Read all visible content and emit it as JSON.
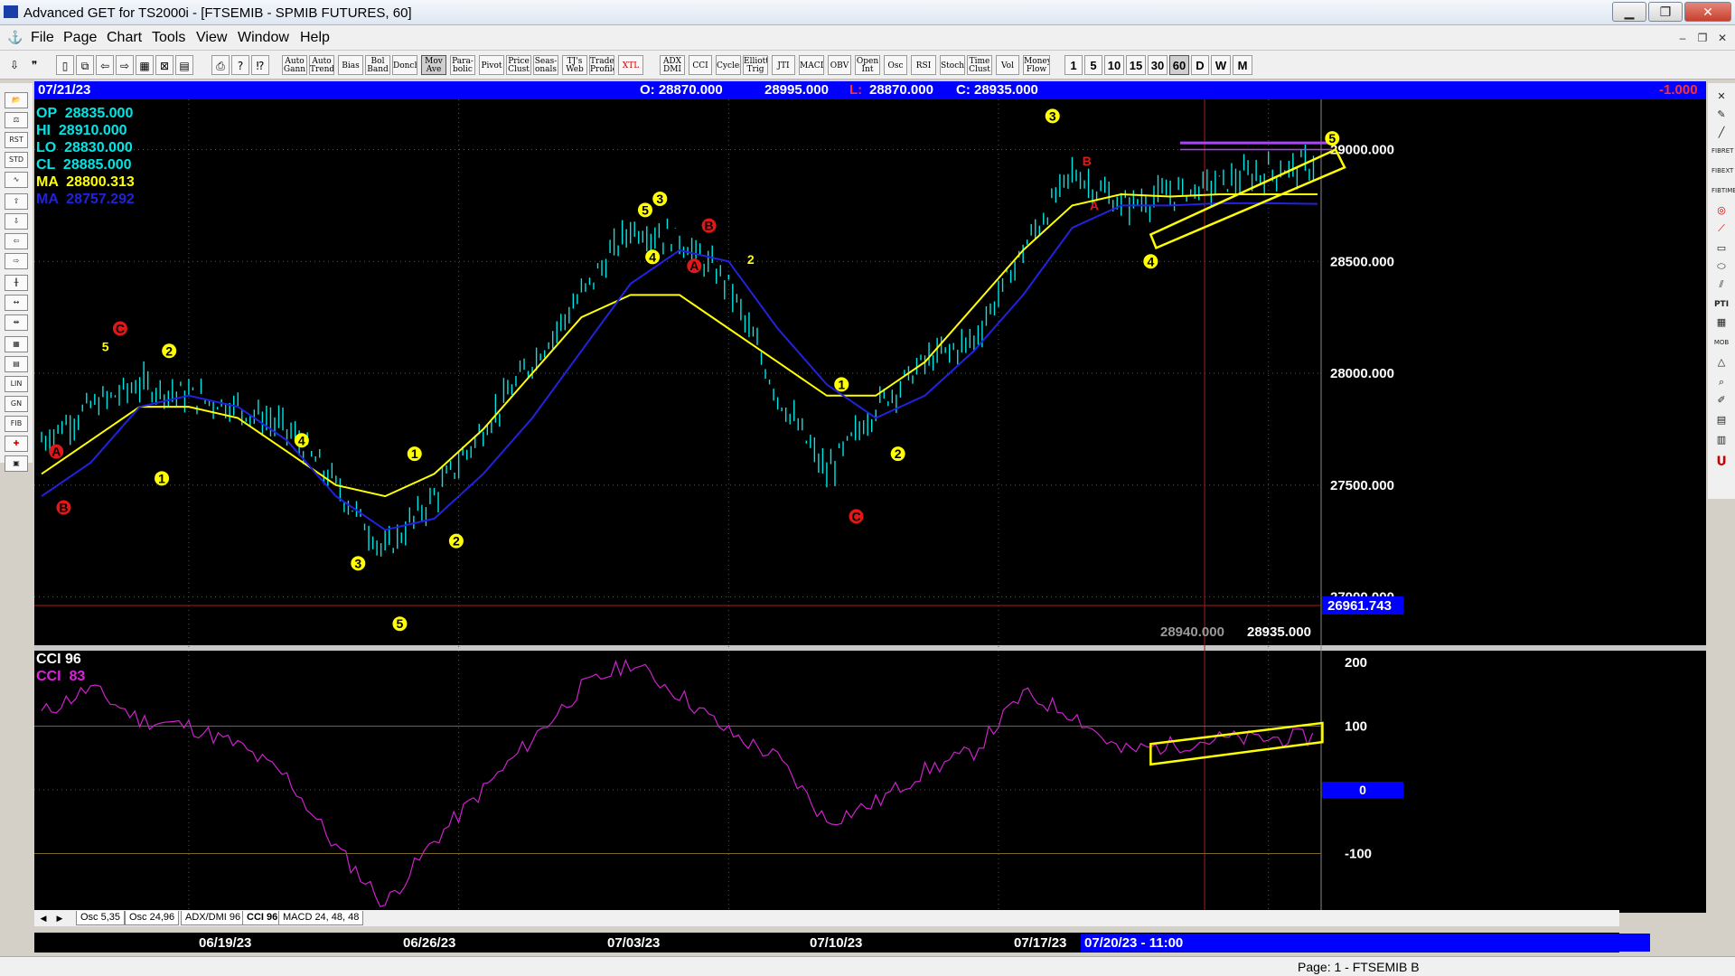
{
  "window": {
    "title": "Advanced GET for TS2000i - [FTSEMIB - SPMIB FUTURES, 60]",
    "controls": {
      "minimize": "▁",
      "maximize": "❐",
      "close": "✕"
    }
  },
  "menu": {
    "items": [
      "File",
      "Page",
      "Chart",
      "Tools",
      "View",
      "Window",
      "Help"
    ]
  },
  "toolbar": {
    "study_buttons": [
      "Auto Gann",
      "Auto Trend",
      "Bias",
      "Bol Band",
      "Donch",
      "Mov Ave",
      "Para- bolic",
      "Pivot",
      "Price Clust",
      "Seas- onals",
      "TJ's Web",
      "Trade Profile",
      "XTL",
      "ADX DMI",
      "CCI",
      "Cycles",
      "Elliott Trig",
      "JTI",
      "MACD",
      "OBV",
      "Open Int",
      "Osc",
      "RSI",
      "Stoch",
      "Time Clust",
      "Vol",
      "Money Flow"
    ],
    "timeframes": [
      "1",
      "5",
      "10",
      "15",
      "30",
      "60",
      "D",
      "W",
      "M"
    ],
    "active_timeframe": "60"
  },
  "infobar": {
    "date": "07/21/23",
    "open": "O: 28870.000",
    "high": "28995.000",
    "low_label": "L:",
    "low": "28870.000",
    "close": "C: 28935.000",
    "change": "-1.000"
  },
  "ohlc_legend": [
    {
      "label": "OP",
      "value": "28835.000",
      "color": "#00e5e5"
    },
    {
      "label": "HI",
      "value": "28910.000",
      "color": "#00e5e5"
    },
    {
      "label": "LO",
      "value": "28830.000",
      "color": "#00e5e5"
    },
    {
      "label": "CL",
      "value": "28885.000",
      "color": "#00e5e5"
    },
    {
      "label": "MA",
      "value": "28800.313",
      "color": "#ffff00"
    },
    {
      "label": "MA",
      "value": "28757.292",
      "color": "#2222dd"
    }
  ],
  "cci_legend": [
    {
      "label": "CCI 96",
      "color": "#ffffff"
    },
    {
      "label": "CCI  83",
      "color": "#dd22dd"
    }
  ],
  "price_panel": {
    "bottom_readouts": [
      "28940.000",
      "28935.000"
    ],
    "level_badge": "26961.743",
    "level_value": 26961.743
  },
  "tabs": [
    "Osc 5,35",
    "Osc 24,96",
    "ADX/DMI 96",
    "CCI 96",
    "MACD 24, 48, 48"
  ],
  "time_axis": {
    "labels": [
      "06/19/23",
      "06/26/23",
      "07/03/23",
      "07/10/23",
      "07/17/23"
    ],
    "current": "07/20/23 - 11:00"
  },
  "status": "Page: 1 - FTSEMIB B",
  "colors": {
    "price": "#00e5e5",
    "ma_fast": "#ffff00",
    "ma_slow": "#2222dd",
    "cci": "#cc22cc",
    "wave_label": "#ffff00",
    "abc_label": "#e01818",
    "info_bar": "#0000ff"
  },
  "chart_data": [
    {
      "type": "line",
      "name": "FTSEMIB - SPMIB FUTURES, 60",
      "x": [
        "06/15",
        "06/16",
        "06/19",
        "06/20",
        "06/21",
        "06/22",
        "06/23",
        "06/26",
        "06/27",
        "06/28",
        "06/29",
        "06/30",
        "07/03",
        "07/04",
        "07/05",
        "07/06",
        "07/07",
        "07/10",
        "07/11",
        "07/12",
        "07/13",
        "07/14",
        "07/17",
        "07/18",
        "07/19",
        "07/20",
        "07/21"
      ],
      "series": [
        {
          "name": "Price",
          "values": [
            27700,
            27850,
            27950,
            27900,
            27850,
            27750,
            27500,
            27200,
            27450,
            27750,
            28050,
            28350,
            28650,
            28600,
            28400,
            27900,
            27550,
            27850,
            28050,
            28150,
            28550,
            28900,
            28750,
            28800,
            28850,
            28900,
            28935
          ]
        },
        {
          "name": "MA",
          "values": [
            27550,
            27700,
            27850,
            27850,
            27800,
            27650,
            27500,
            27450,
            27550,
            27750,
            28000,
            28250,
            28350,
            28350,
            28200,
            28050,
            27900,
            27900,
            28050,
            28300,
            28550,
            28750,
            28800,
            28790,
            28800,
            28800,
            28800
          ]
        },
        {
          "name": "MA",
          "values": [
            27450,
            27600,
            27850,
            27900,
            27850,
            27700,
            27450,
            27300,
            27350,
            27550,
            27800,
            28100,
            28400,
            28550,
            28500,
            28200,
            27950,
            27800,
            27900,
            28100,
            28350,
            28650,
            28750,
            28750,
            28760,
            28760,
            28757
          ]
        }
      ],
      "ylim": [
        26800,
        29200
      ],
      "yticks": [
        "29000.000",
        "28500.000",
        "28000.000",
        "27500.000",
        "27000.000"
      ],
      "ytick_values": [
        29000,
        28500,
        28000,
        27500,
        27000
      ],
      "xticks": [
        "06/19/23",
        "06/26/23",
        "07/03/23",
        "07/10/23",
        "07/17/23"
      ],
      "wave_labels": [
        {
          "text": "A",
          "x": "06/15",
          "y": 27650,
          "color": "#e01818",
          "circle": true
        },
        {
          "text": "B",
          "x": "06/15",
          "y": 27400,
          "color": "#e01818",
          "circle": true
        },
        {
          "text": "C",
          "x": "06/16",
          "y": 28200,
          "color": "#e01818",
          "circle": true
        },
        {
          "text": "5",
          "x": "06/16",
          "y": 28120,
          "color": "#ffff00",
          "circle": false
        },
        {
          "text": "1",
          "x": "06/19",
          "y": 27530,
          "color": "#ffff00",
          "circle": true
        },
        {
          "text": "2",
          "x": "06/19",
          "y": 28100,
          "color": "#ffff00",
          "circle": true
        },
        {
          "text": "4",
          "x": "06/22",
          "y": 27700,
          "color": "#ffff00",
          "circle": true
        },
        {
          "text": "3",
          "x": "06/23",
          "y": 27150,
          "color": "#ffff00",
          "circle": true
        },
        {
          "text": "1",
          "x": "06/26",
          "y": 27640,
          "color": "#ffff00",
          "circle": true
        },
        {
          "text": "5",
          "x": "06/26",
          "y": 26880,
          "color": "#ffff00",
          "circle": true
        },
        {
          "text": "2",
          "x": "06/27",
          "y": 27250,
          "color": "#ffff00",
          "circle": true
        },
        {
          "text": "3",
          "x": "07/03",
          "y": 28780,
          "color": "#ffff00",
          "circle": true
        },
        {
          "text": "5",
          "x": "07/03",
          "y": 28730,
          "color": "#ffff00",
          "circle": true
        },
        {
          "text": "4",
          "x": "07/03",
          "y": 28520,
          "color": "#ffff00",
          "circle": true
        },
        {
          "text": "B",
          "x": "07/04",
          "y": 28660,
          "color": "#e01818",
          "circle": true
        },
        {
          "text": "A",
          "x": "07/04",
          "y": 28480,
          "color": "#e01818",
          "circle": true
        },
        {
          "text": "2",
          "x": "07/05",
          "y": 28510,
          "color": "#ffff00",
          "circle": false
        },
        {
          "text": "C",
          "x": "07/07",
          "y": 27360,
          "color": "#e01818",
          "circle": true
        },
        {
          "text": "1",
          "x": "07/07",
          "y": 27950,
          "color": "#ffff00",
          "circle": true
        },
        {
          "text": "2",
          "x": "07/10",
          "y": 27640,
          "color": "#ffff00",
          "circle": true
        },
        {
          "text": "3",
          "x": "07/13",
          "y": 29150,
          "color": "#ffff00",
          "circle": true
        },
        {
          "text": "B",
          "x": "07/14",
          "y": 28950,
          "color": "#e01818",
          "circle": false
        },
        {
          "text": "A",
          "x": "07/14",
          "y": 28750,
          "color": "#e01818",
          "circle": false
        },
        {
          "text": "4",
          "x": "07/17",
          "y": 28500,
          "color": "#ffff00",
          "circle": true
        },
        {
          "text": "5",
          "x": "07/21",
          "y": 29050,
          "color": "#ffff00",
          "circle": true
        }
      ]
    },
    {
      "type": "line",
      "name": "CCI 96",
      "x": [
        "06/15",
        "06/16",
        "06/19",
        "06/20",
        "06/21",
        "06/22",
        "06/23",
        "06/26",
        "06/27",
        "06/28",
        "06/29",
        "06/30",
        "07/03",
        "07/04",
        "07/05",
        "07/06",
        "07/07",
        "07/10",
        "07/11",
        "07/12",
        "07/13",
        "07/14",
        "07/17",
        "07/18",
        "07/19",
        "07/20",
        "07/21"
      ],
      "series": [
        {
          "name": "CCI  83",
          "values": [
            120,
            160,
            110,
            100,
            70,
            20,
            -90,
            -180,
            -80,
            0,
            80,
            160,
            200,
            150,
            90,
            50,
            -50,
            -20,
            30,
            60,
            150,
            120,
            60,
            70,
            80,
            80,
            83
          ]
        }
      ],
      "ylim": [
        -190,
        210
      ],
      "yticks": [
        "200",
        "100",
        "-100"
      ],
      "ytick_values": [
        200,
        100,
        -100
      ],
      "zero_label": "0"
    }
  ]
}
